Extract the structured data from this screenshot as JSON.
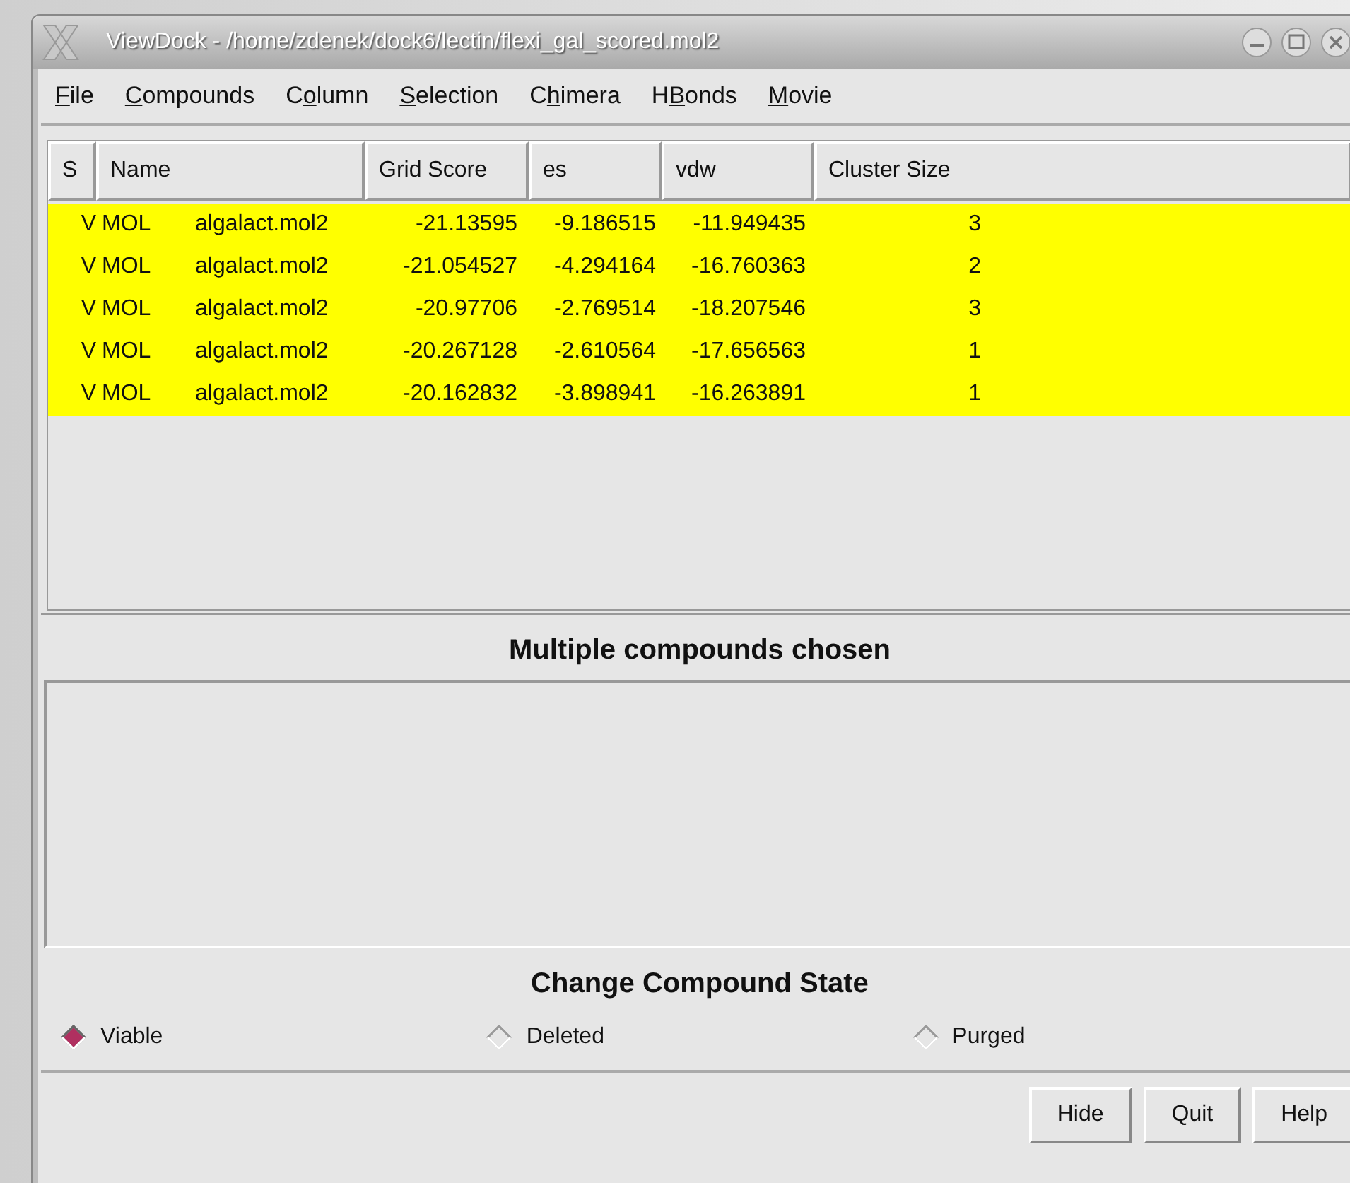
{
  "window": {
    "title": "ViewDock - /home/zdenek/dock6/lectin/flexi_gal_scored.mol2"
  },
  "menu": [
    {
      "key": "F",
      "after": "ile"
    },
    {
      "key": "C",
      "after": "ompounds"
    },
    {
      "before": "C",
      "key": "o",
      "after": "lumn"
    },
    {
      "key": "S",
      "after": "election"
    },
    {
      "before": "C",
      "key": "h",
      "after": "imera"
    },
    {
      "before": "H",
      "key": "B",
      "after": "onds"
    },
    {
      "key": "M",
      "after": "ovie"
    }
  ],
  "table": {
    "columns": [
      "S",
      "Name",
      "Grid Score",
      "es",
      "vdw",
      "Cluster Size"
    ],
    "rows": [
      {
        "s": "V",
        "name": "MOL",
        "file": "algalact.mol2",
        "grid_score": "-21.13595",
        "es": "-9.186515",
        "vdw": "-11.949435",
        "cluster_size": "3",
        "selected": true
      },
      {
        "s": "V",
        "name": "MOL",
        "file": "algalact.mol2",
        "grid_score": "-21.054527",
        "es": "-4.294164",
        "vdw": "-16.760363",
        "cluster_size": "2",
        "selected": true
      },
      {
        "s": "V",
        "name": "MOL",
        "file": "algalact.mol2",
        "grid_score": "-20.97706",
        "es": "-2.769514",
        "vdw": "-18.207546",
        "cluster_size": "3",
        "selected": true
      },
      {
        "s": "V",
        "name": "MOL",
        "file": "algalact.mol2",
        "grid_score": "-20.267128",
        "es": "-2.610564",
        "vdw": "-17.656563",
        "cluster_size": "1",
        "selected": true
      },
      {
        "s": "V",
        "name": "MOL",
        "file": "algalact.mol2",
        "grid_score": "-20.162832",
        "es": "-3.898941",
        "vdw": "-16.263891",
        "cluster_size": "1",
        "selected": true
      }
    ]
  },
  "info": {
    "heading": "Multiple compounds chosen"
  },
  "state": {
    "heading": "Change Compound State",
    "options": [
      {
        "label": "Viable",
        "selected": true
      },
      {
        "label": "Deleted",
        "selected": false
      },
      {
        "label": "Purged",
        "selected": false
      }
    ]
  },
  "buttons": [
    "Hide",
    "Quit",
    "Help"
  ]
}
